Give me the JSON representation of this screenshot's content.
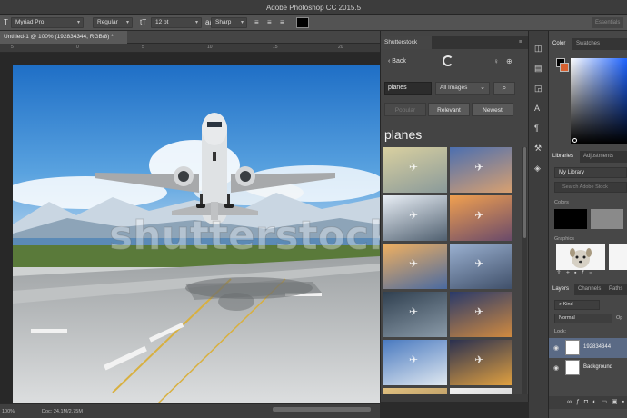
{
  "app": {
    "title": "Adobe Photoshop CC 2015.5"
  },
  "options_bar": {
    "font_family": "Myriad Pro",
    "font_style": "Regular",
    "font_size": "12 pt",
    "antialias": "Sharp",
    "workspace": "Essentials",
    "text_color": "#000000"
  },
  "document": {
    "tab_title": "Untitled-1 @ 100% (192834344, RGB/8) *",
    "ruler_labels": [
      "5",
      "0",
      "5",
      "10",
      "15",
      "20"
    ],
    "watermark": "shutterstock"
  },
  "status": {
    "zoom": "100%",
    "doc_info": "Doc: 24.1M/2.75M"
  },
  "shutterstock": {
    "panel_title": "Shutterstock",
    "back_label": "Back",
    "search_value": "planes",
    "search_filter": "All Images",
    "sort_tabs": [
      {
        "label": "Popular",
        "state": "disabled"
      },
      {
        "label": "Relevant",
        "state": "normal"
      },
      {
        "label": "Newest",
        "state": "normal"
      }
    ],
    "results_heading": "planes",
    "thumbnails": [
      {
        "alt": "plane-sunset-haze",
        "c1": "#d9d0a0",
        "c2": "#8a9a9a"
      },
      {
        "alt": "plane-blue-sky",
        "c1": "#4c6fb0",
        "c2": "#d8a070"
      },
      {
        "alt": "plane-window-view",
        "c1": "#e8eef5",
        "c2": "#506070"
      },
      {
        "alt": "plane-sunset-orange",
        "c1": "#f0a050",
        "c2": "#6a4a6a"
      },
      {
        "alt": "plane-golden-clouds",
        "c1": "#f0b060",
        "c2": "#4a6aa0"
      },
      {
        "alt": "plane-runway-sky",
        "c1": "#9ab0d0",
        "c2": "#40506a"
      },
      {
        "alt": "passenger-window",
        "c1": "#304050",
        "c2": "#8a9aa8"
      },
      {
        "alt": "plane-dusk-city",
        "c1": "#2a3a6a",
        "c2": "#d08a40"
      },
      {
        "alt": "plane-over-clouds",
        "c1": "#4a7ac0",
        "c2": "#e0e8f0"
      },
      {
        "alt": "plane-takeoff-sunset",
        "c1": "#2a3050",
        "c2": "#e0a040"
      },
      {
        "alt": "plane-sand",
        "c1": "#e0c080",
        "c2": "#a08050"
      },
      {
        "alt": "plane-white",
        "c1": "#f0f0f0",
        "c2": "#c0c0c0"
      }
    ]
  },
  "right_panel": {
    "color_tabs": [
      "Color",
      "Swatches"
    ],
    "library_tabs": [
      "Libraries",
      "Adjustments"
    ],
    "library_select": "My Library",
    "library_search_placeholder": "Search Adobe Stock",
    "library_colors_label": "Colors",
    "library_graphics_label": "Graphics",
    "library_colors": [
      "#000000",
      "#8a8a8a"
    ],
    "layers_tabs": [
      "Layers",
      "Channels",
      "Paths"
    ],
    "layer_filter": "Kind",
    "blend_mode": "Normal",
    "opacity_label": "Op",
    "lock_label": "Lock:",
    "layers": [
      {
        "name": "192834344",
        "selected": true
      },
      {
        "name": "Background",
        "selected": false
      }
    ],
    "fg_color": "#000000",
    "bg_color": "#d7602f"
  }
}
